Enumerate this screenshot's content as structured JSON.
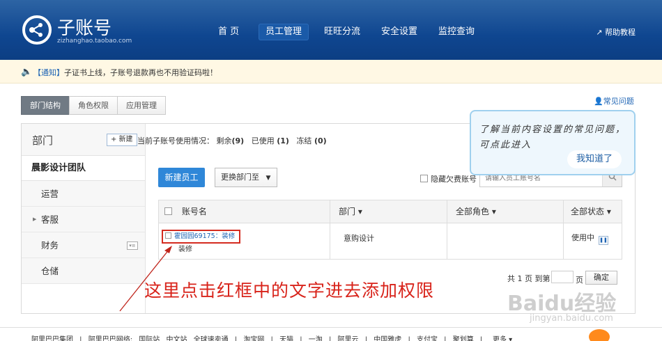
{
  "header": {
    "logo_name": "子账号",
    "logo_domain": "zizhanghao.taobao.com",
    "nav": [
      "首 页",
      "员工管理",
      "旺旺分流",
      "安全设置",
      "监控查询"
    ],
    "active_nav": "员工管理",
    "help": "帮助教程"
  },
  "notice": {
    "tag": "【通知】",
    "text": "子证书上线，子账号退款再也不用验证码啦！"
  },
  "tabs": [
    "部门结构",
    "角色权限",
    "应用管理"
  ],
  "faq": "常见问题",
  "sidebar": {
    "title": "部门",
    "new_button": "+ 新建",
    "team": "晨影设计团队",
    "items": [
      {
        "label": "运营"
      },
      {
        "label": "客服"
      },
      {
        "label": "财务"
      },
      {
        "label": "仓储"
      }
    ]
  },
  "usage": {
    "label": "当前子账号使用情况：",
    "remaining_label": "剩余",
    "remaining": "(9)",
    "used_label": "已使用",
    "used": "(1)",
    "frozen_label": "冻结",
    "frozen": "(0)"
  },
  "toolbar": {
    "new_employee": "新建员工",
    "move_dept": "更换部门至",
    "hide_owed": "隐藏欠费账号",
    "search_placeholder": "请输入员工账号名"
  },
  "table": {
    "headers": [
      "账号名",
      "部门 ▾",
      "全部角色 ▾",
      "全部状态 ▾"
    ],
    "rows": [
      {
        "account": "霍园园69175：装修",
        "account_sub": "装修",
        "dept": "意购设计",
        "role": "",
        "status": "使用中"
      }
    ]
  },
  "pager": {
    "total": "共 1 页 到第",
    "unit": "页",
    "confirm": "确定"
  },
  "tooltip": {
    "text": "了解当前内容设置的常见问题，可点此进入",
    "button": "我知道了"
  },
  "annotation": "这里点击红框中的文字进去添加权限",
  "watermark": {
    "brand": "Baidu经验",
    "url": "jingyan.baidu.com"
  },
  "footer": {
    "links": "阿里巴巴集团 | 阿里巴巴网络: 国际站 中文站 全球速卖通 | 淘宝网 | 天猫 | 一淘 | 阿里云 | 中国雅虎 | 支付宝 | 聚划算 |",
    "more": "更多"
  },
  "colors": {
    "header": "#0f4690",
    "accent": "#2f87d8",
    "highlight_box": "#d42b1f",
    "annotation": "#d8231a"
  }
}
